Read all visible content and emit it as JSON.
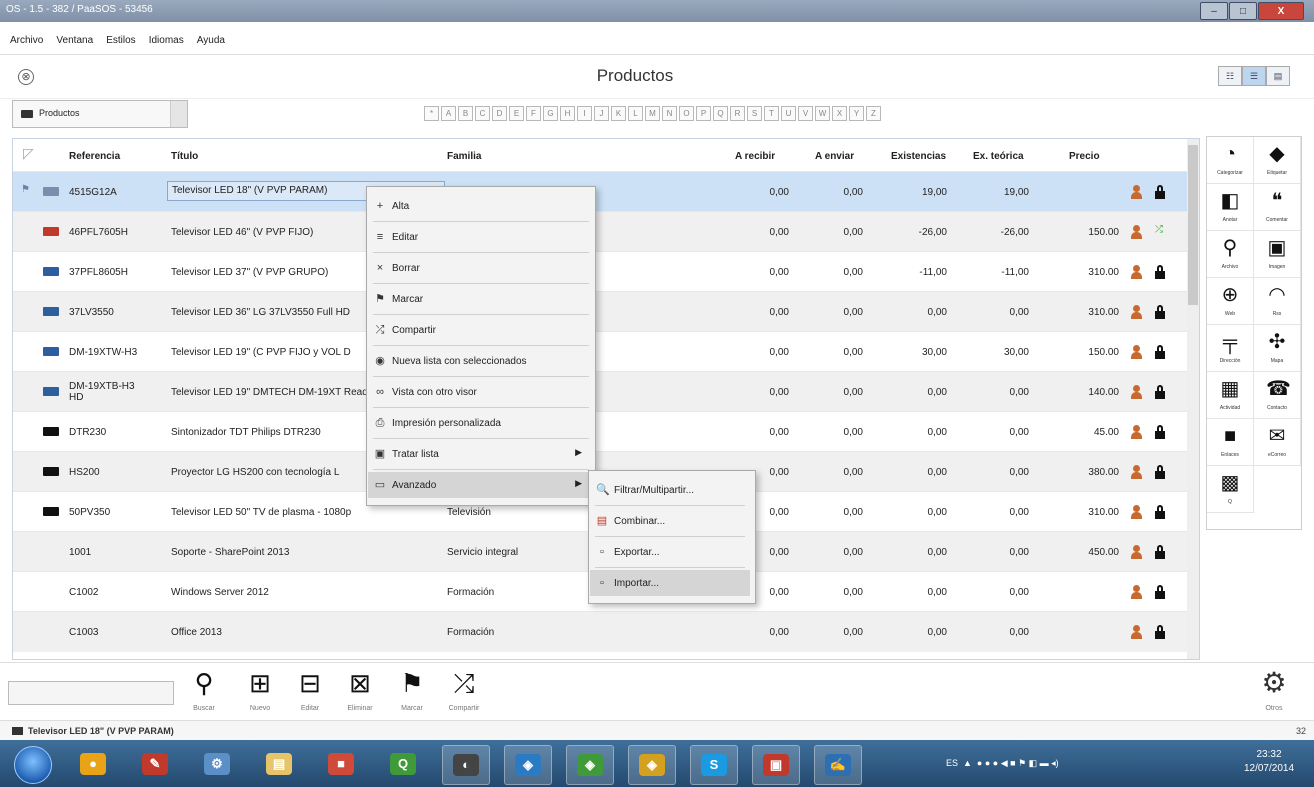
{
  "window": {
    "title": "OS - 1.5 - 382 / PaaSOS - 53456",
    "buttons": [
      "–",
      "□",
      "X"
    ]
  },
  "menubar": [
    "Archivo",
    "Ventana",
    "Estilos",
    "Idiomas",
    "Ayuda"
  ],
  "header": {
    "title": "Productos",
    "close_glyph": "⊗",
    "view_toggle": [
      "☷",
      "☰",
      "▤"
    ]
  },
  "selector": {
    "label": "Productos"
  },
  "alphabet": [
    "*",
    "A",
    "B",
    "C",
    "D",
    "E",
    "F",
    "G",
    "H",
    "I",
    "J",
    "K",
    "L",
    "M",
    "N",
    "O",
    "P",
    "Q",
    "R",
    "S",
    "T",
    "U",
    "V",
    "W",
    "X",
    "Y",
    "Z"
  ],
  "grid": {
    "columns": [
      "Referencia",
      "Título",
      "Familia",
      "A recibir",
      "A enviar",
      "Existencias",
      "Ex. teórica",
      "Precio"
    ],
    "rows": [
      {
        "ref": "4515G12A",
        "titulo": "Televisor LED 18\" (V PVP PARAM)",
        "familia": "",
        "recibir": "0,00",
        "enviar": "0,00",
        "existencias": "19,00",
        "teorica": "19,00",
        "precio": "",
        "status": "lock"
      },
      {
        "ref": "46PFL7605H",
        "titulo": "Televisor LED 46\" (V PVP FIJO)",
        "familia": "",
        "recibir": "0,00",
        "enviar": "0,00",
        "existencias": "-26,00",
        "teorica": "-26,00",
        "precio": "150.00",
        "status": "shuffle"
      },
      {
        "ref": "37PFL8605H",
        "titulo": "Televisor LED 37\" (V PVP GRUPO)",
        "familia": "",
        "recibir": "0,00",
        "enviar": "0,00",
        "existencias": "-11,00",
        "teorica": "-11,00",
        "precio": "310.00",
        "status": "lock"
      },
      {
        "ref": "37LV3550",
        "titulo": "Televisor LED 36\" LG 37LV3550 Full HD",
        "familia": "",
        "recibir": "0,00",
        "enviar": "0,00",
        "existencias": "0,00",
        "teorica": "0,00",
        "precio": "310.00",
        "status": "lock"
      },
      {
        "ref": "DM-19XTW-H3",
        "titulo": "Televisor LED 19\" (C PVP FIJO y VOL D",
        "familia": "",
        "recibir": "0,00",
        "enviar": "0,00",
        "existencias": "30,00",
        "teorica": "30,00",
        "precio": "150.00",
        "status": "lock"
      },
      {
        "ref": "DM-19XTB-H3 HD",
        "titulo": "Televisor LED 19\" DMTECH DM-19XT Ready",
        "familia": "",
        "recibir": "0,00",
        "enviar": "0,00",
        "existencias": "0,00",
        "teorica": "0,00",
        "precio": "140.00",
        "status": "lock"
      },
      {
        "ref": "DTR230",
        "titulo": "Sintonizador TDT Philips DTR230",
        "familia": "",
        "recibir": "0,00",
        "enviar": "0,00",
        "existencias": "0,00",
        "teorica": "0,00",
        "precio": "45.00",
        "status": "lock"
      },
      {
        "ref": "HS200",
        "titulo": "Proyector LG HS200 con tecnología L",
        "familia": "",
        "recibir": "0,00",
        "enviar": "0,00",
        "existencias": "0,00",
        "teorica": "0,00",
        "precio": "380.00",
        "status": "lock"
      },
      {
        "ref": "50PV350",
        "titulo": "Televisor LED 50\" TV de plasma - 1080p",
        "familia": "Televisión",
        "recibir": "0,00",
        "enviar": "0,00",
        "existencias": "0,00",
        "teorica": "0,00",
        "precio": "310.00",
        "status": "lock"
      },
      {
        "ref": "1001",
        "titulo": "Soporte - SharePoint 2013",
        "familia": "Servicio integral",
        "recibir": "0,00",
        "enviar": "0,00",
        "existencias": "0,00",
        "teorica": "0,00",
        "precio": "450.00",
        "status": "lock"
      },
      {
        "ref": "C1002",
        "titulo": "Windows Server 2012",
        "familia": "Formación",
        "recibir": "0,00",
        "enviar": "0,00",
        "existencias": "0,00",
        "teorica": "0,00",
        "precio": "",
        "status": "lock"
      },
      {
        "ref": "C1003",
        "titulo": "Office 2013",
        "familia": "Formación",
        "recibir": "0,00",
        "enviar": "0,00",
        "existencias": "0,00",
        "teorica": "0,00",
        "precio": "",
        "status": "lock"
      }
    ]
  },
  "context_menu": {
    "items": [
      {
        "label": "Alta",
        "icon": "+"
      },
      {
        "label": "Editar",
        "icon": "≡"
      },
      {
        "label": "Borrar",
        "icon": "×"
      },
      {
        "label": "Marcar",
        "icon": "⚑"
      },
      {
        "label": "Compartir",
        "icon": "⤮"
      },
      {
        "label": "Nueva lista con seleccionados",
        "icon": "◉"
      },
      {
        "label": "Vista con otro visor",
        "icon": "∞"
      },
      {
        "label": "Impresión personalizada",
        "icon": "⎙"
      },
      {
        "label": "Tratar lista",
        "icon": "▣"
      },
      {
        "label": "Avanzado",
        "icon": "▭"
      }
    ]
  },
  "submenu": {
    "items": [
      {
        "label": "Filtrar/Multipartir...",
        "icon": "🔍"
      },
      {
        "label": "Combinar...",
        "icon": "▤"
      },
      {
        "label": "Exportar...",
        "icon": "▫"
      },
      {
        "label": "Importar...",
        "icon": "▫"
      }
    ]
  },
  "right_panel": {
    "tiles": [
      {
        "label": "Categorizar",
        "glyph": "◔"
      },
      {
        "label": "Etiquetar",
        "glyph": "◆"
      },
      {
        "label": "Anotar",
        "glyph": "◧"
      },
      {
        "label": "Comentar",
        "glyph": "❝"
      },
      {
        "label": "Archivo",
        "glyph": "⚲"
      },
      {
        "label": "Imagen",
        "glyph": "▣"
      },
      {
        "label": "Web",
        "glyph": "⊕"
      },
      {
        "label": "Rss",
        "glyph": "◠"
      },
      {
        "label": "Dirección",
        "glyph": "╤"
      },
      {
        "label": "Mapa",
        "glyph": "✣"
      },
      {
        "label": "Actividad",
        "glyph": "▦"
      },
      {
        "label": "Contacto",
        "glyph": "☎"
      },
      {
        "label": "Enlaces",
        "glyph": "■"
      },
      {
        "label": "eCorreo",
        "glyph": "✉"
      },
      {
        "label": "Q",
        "glyph": "▩"
      }
    ]
  },
  "bottom_toolbar": {
    "buttons": [
      {
        "label": "Buscar",
        "glyph": "⚲"
      },
      {
        "label": "Nuevo",
        "glyph": "⊞"
      },
      {
        "label": "Editar",
        "glyph": "⊟"
      },
      {
        "label": "Eliminar",
        "glyph": "⊠"
      },
      {
        "label": "Marcar",
        "glyph": "⚑"
      },
      {
        "label": "Compartir",
        "glyph": "⤮"
      }
    ],
    "otros": {
      "label": "Otros",
      "glyph": "⚙"
    }
  },
  "status": {
    "text": "Televisor LED 18\" (V PVP PARAM)",
    "count": "32"
  },
  "taskbar": {
    "tray_lang": "ES",
    "time": "23:32",
    "date": "12/07/2014",
    "apps": [
      {
        "name": "chrome",
        "glyph": "●",
        "color": "#e8a317"
      },
      {
        "name": "paint",
        "glyph": "✎",
        "color": "#c0392b"
      },
      {
        "name": "tools",
        "glyph": "⚙",
        "color": "#5b8fc7"
      },
      {
        "name": "explorer",
        "glyph": "▤",
        "color": "#e5c46a"
      },
      {
        "name": "apps",
        "glyph": "■",
        "color": "#d04a3a"
      },
      {
        "name": "qlik",
        "glyph": "Q",
        "color": "#3f9a3a"
      },
      {
        "name": "os-app-1",
        "glyph": "◐",
        "color": "#444"
      },
      {
        "name": "os-app-2",
        "glyph": "◈",
        "color": "#2b7bc4"
      },
      {
        "name": "os-app-3",
        "glyph": "◈",
        "color": "#3f9a3a"
      },
      {
        "name": "os-app-4",
        "glyph": "◈",
        "color": "#d4a020"
      },
      {
        "name": "skype",
        "glyph": "S",
        "color": "#1a9ae0"
      },
      {
        "name": "remote",
        "glyph": "▣",
        "color": "#c0392b"
      },
      {
        "name": "pen",
        "glyph": "✍",
        "color": "#2c6fb2"
      }
    ]
  }
}
